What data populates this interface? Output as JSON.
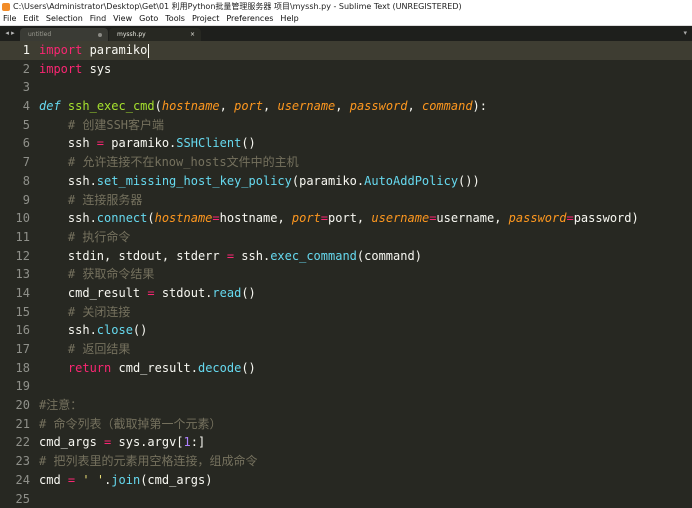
{
  "window": {
    "title": "C:\\Users\\Administrator\\Desktop\\Get\\01 利用Python批量管理服务器 项目\\myssh.py - Sublime Text (UNREGISTERED)"
  },
  "menu": [
    "File",
    "Edit",
    "Selection",
    "Find",
    "View",
    "Goto",
    "Tools",
    "Project",
    "Preferences",
    "Help"
  ],
  "tabs": [
    {
      "label": "untitled",
      "active": false
    },
    {
      "label": "myssh.py",
      "active": true,
      "close": "×"
    }
  ],
  "nav": {
    "arrows": "◂ ▸",
    "dropdown": "▾"
  },
  "editor": {
    "line_numbers": [
      "1",
      "2",
      "3",
      "4",
      "5",
      "6",
      "7",
      "8",
      "9",
      "10",
      "11",
      "12",
      "13",
      "14",
      "15",
      "16",
      "17",
      "18",
      "19",
      "20",
      "21",
      "22",
      "23",
      "24",
      "25"
    ],
    "active_line": 1,
    "lines": [
      [
        {
          "t": "import",
          "c": "kw"
        },
        {
          "t": " paramiko"
        }
      ],
      [
        {
          "t": "import",
          "c": "kw"
        },
        {
          "t": " sys"
        }
      ],
      [],
      [
        {
          "t": "def",
          "c": "df"
        },
        {
          "t": " "
        },
        {
          "t": "ssh_exec_cmd",
          "c": "fn"
        },
        {
          "t": "("
        },
        {
          "t": "hostname",
          "c": "pa"
        },
        {
          "t": ", "
        },
        {
          "t": "port",
          "c": "pa"
        },
        {
          "t": ", "
        },
        {
          "t": "username",
          "c": "pa"
        },
        {
          "t": ", "
        },
        {
          "t": "password",
          "c": "pa"
        },
        {
          "t": ", "
        },
        {
          "t": "command",
          "c": "pa"
        },
        {
          "t": "):"
        }
      ],
      [
        {
          "t": "    "
        },
        {
          "t": "# 创建SSH客户端",
          "c": "cm"
        }
      ],
      [
        {
          "t": "    ssh "
        },
        {
          "t": "=",
          "c": "kw"
        },
        {
          "t": " paramiko."
        },
        {
          "t": "SSHClient",
          "c": "bi"
        },
        {
          "t": "()"
        }
      ],
      [
        {
          "t": "    "
        },
        {
          "t": "# 允许连接不在know_hosts文件中的主机",
          "c": "cm"
        }
      ],
      [
        {
          "t": "    ssh."
        },
        {
          "t": "set_missing_host_key_policy",
          "c": "bi"
        },
        {
          "t": "(paramiko."
        },
        {
          "t": "AutoAddPolicy",
          "c": "bi"
        },
        {
          "t": "())"
        }
      ],
      [
        {
          "t": "    "
        },
        {
          "t": "# 连接服务器",
          "c": "cm"
        }
      ],
      [
        {
          "t": "    ssh."
        },
        {
          "t": "connect",
          "c": "bi"
        },
        {
          "t": "("
        },
        {
          "t": "hostname",
          "c": "pa"
        },
        {
          "t": "=",
          "c": "kw"
        },
        {
          "t": "hostname, "
        },
        {
          "t": "port",
          "c": "pa"
        },
        {
          "t": "=",
          "c": "kw"
        },
        {
          "t": "port, "
        },
        {
          "t": "username",
          "c": "pa"
        },
        {
          "t": "=",
          "c": "kw"
        },
        {
          "t": "username, "
        },
        {
          "t": "password",
          "c": "pa"
        },
        {
          "t": "=",
          "c": "kw"
        },
        {
          "t": "password)"
        }
      ],
      [
        {
          "t": "    "
        },
        {
          "t": "# 执行命令",
          "c": "cm"
        }
      ],
      [
        {
          "t": "    stdin, stdout, stderr "
        },
        {
          "t": "=",
          "c": "kw"
        },
        {
          "t": " ssh."
        },
        {
          "t": "exec_command",
          "c": "bi"
        },
        {
          "t": "(command)"
        }
      ],
      [
        {
          "t": "    "
        },
        {
          "t": "# 获取命令结果",
          "c": "cm"
        }
      ],
      [
        {
          "t": "    cmd_result "
        },
        {
          "t": "=",
          "c": "kw"
        },
        {
          "t": " stdout."
        },
        {
          "t": "read",
          "c": "bi"
        },
        {
          "t": "()"
        }
      ],
      [
        {
          "t": "    "
        },
        {
          "t": "# 关闭连接",
          "c": "cm"
        }
      ],
      [
        {
          "t": "    ssh."
        },
        {
          "t": "close",
          "c": "bi"
        },
        {
          "t": "()"
        }
      ],
      [
        {
          "t": "    "
        },
        {
          "t": "# 返回结果",
          "c": "cm"
        }
      ],
      [
        {
          "t": "    "
        },
        {
          "t": "return",
          "c": "kw"
        },
        {
          "t": " cmd_result."
        },
        {
          "t": "decode",
          "c": "bi"
        },
        {
          "t": "()"
        }
      ],
      [],
      [
        {
          "t": "#注意：",
          "c": "cm"
        }
      ],
      [
        {
          "t": "# 命令列表（截取掉第一个元素）",
          "c": "cm"
        }
      ],
      [
        {
          "t": "cmd_args "
        },
        {
          "t": "=",
          "c": "kw"
        },
        {
          "t": " sys.argv["
        },
        {
          "t": "1",
          "c": "nm"
        },
        {
          "t": ":]"
        }
      ],
      [
        {
          "t": "# 把列表里的元素用空格连接，组成命令",
          "c": "cm"
        }
      ],
      [
        {
          "t": "cmd "
        },
        {
          "t": "=",
          "c": "kw"
        },
        {
          "t": " "
        },
        {
          "t": "' '",
          "c": "st"
        },
        {
          "t": "."
        },
        {
          "t": "join",
          "c": "bi"
        },
        {
          "t": "(cmd_args)"
        }
      ],
      []
    ]
  }
}
